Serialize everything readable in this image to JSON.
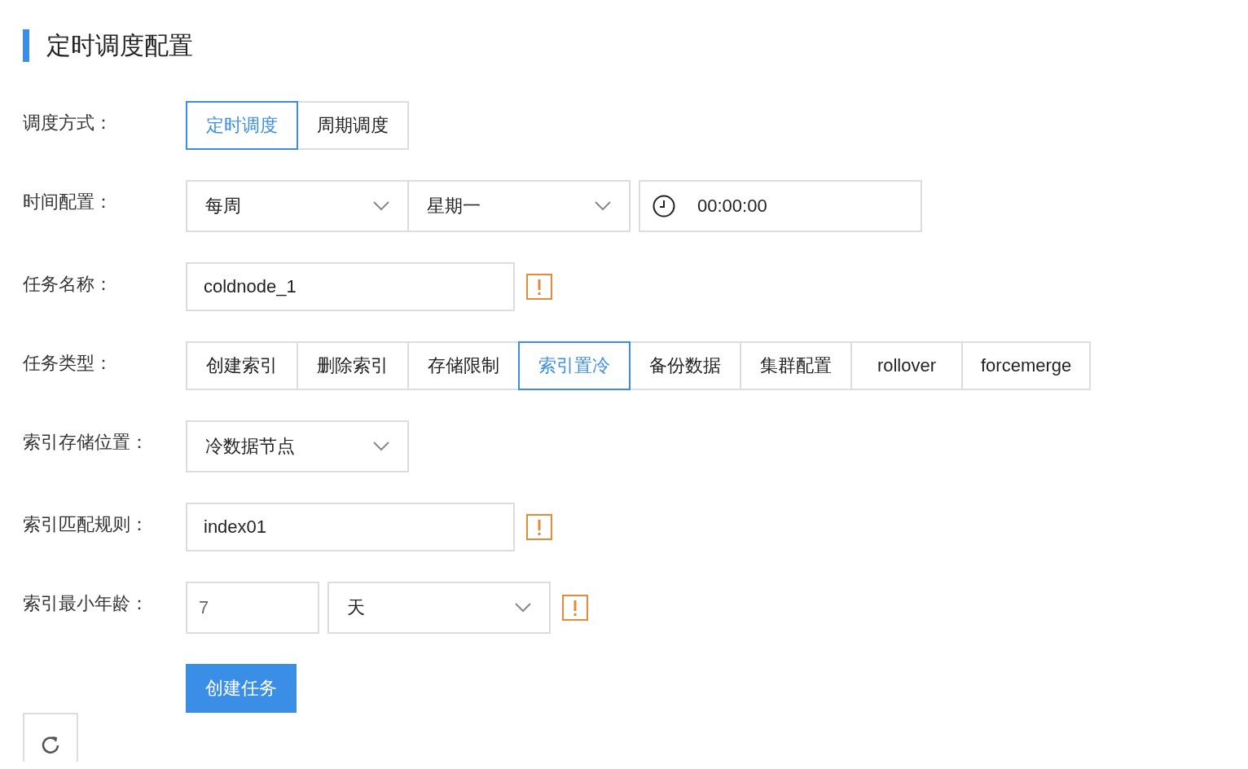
{
  "title": "定时调度配置",
  "fields": [
    {
      "kind": "segmented",
      "label": "调度方式：",
      "options": [
        {
          "label": "定时调度",
          "selected": true
        },
        {
          "label": "周期调度",
          "selected": false
        }
      ]
    },
    {
      "kind": "time",
      "label": "时间配置：",
      "selects": [
        "每周",
        "星期一"
      ],
      "time": "00:00:00"
    },
    {
      "kind": "input",
      "label": "任务名称：",
      "value": "coldnode_1",
      "warning": true
    },
    {
      "kind": "segmented",
      "label": "任务类型：",
      "options": [
        {
          "label": "创建索引",
          "selected": false
        },
        {
          "label": "删除索引",
          "selected": false
        },
        {
          "label": "存储限制",
          "selected": false
        },
        {
          "label": "索引置冷",
          "selected": true
        },
        {
          "label": "备份数据",
          "selected": false
        },
        {
          "label": "集群配置",
          "selected": false
        },
        {
          "label": "rollover",
          "selected": false
        },
        {
          "label": "forcemerge",
          "selected": false
        }
      ]
    },
    {
      "kind": "select",
      "label": "索引存储位置：",
      "value": "冷数据节点"
    },
    {
      "kind": "input",
      "label": "索引匹配规则：",
      "value": "index01",
      "warning": true
    },
    {
      "kind": "age",
      "label": "索引最小年龄：",
      "value": "7",
      "unit": "天",
      "warning": true
    }
  ],
  "submit": "创建任务"
}
